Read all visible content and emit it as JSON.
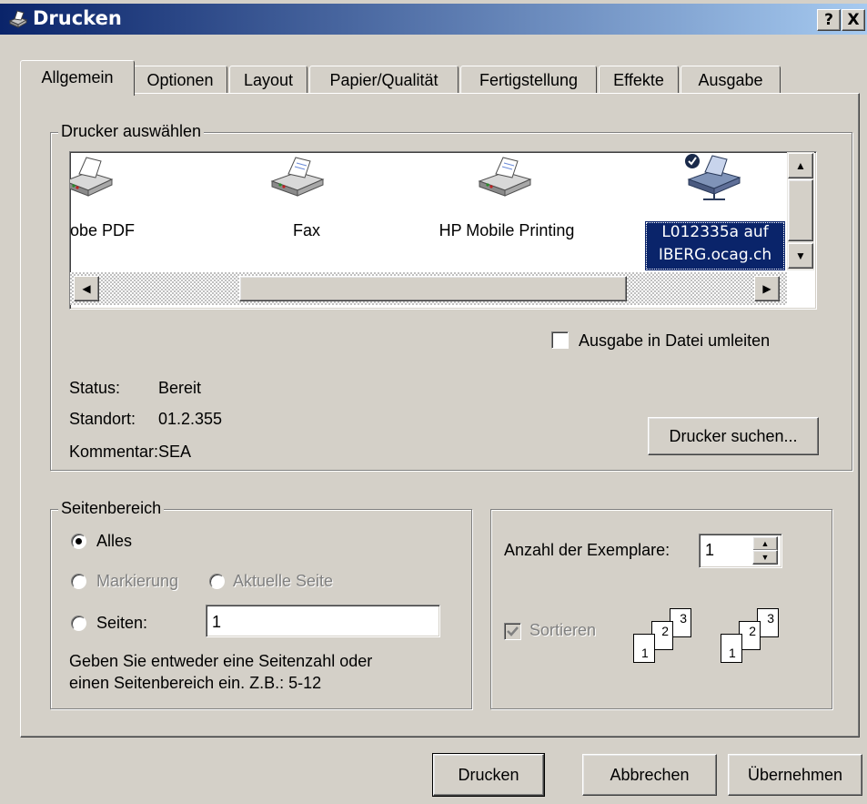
{
  "window": {
    "title": "Drucken",
    "help_button": "?",
    "close_button": "X"
  },
  "tabs": [
    {
      "label": "Allgemein",
      "active": true
    },
    {
      "label": "Optionen",
      "active": false
    },
    {
      "label": "Layout",
      "active": false
    },
    {
      "label": "Papier/Qualität",
      "active": false
    },
    {
      "label": "Fertigstellung",
      "active": false
    },
    {
      "label": "Effekte",
      "active": false
    },
    {
      "label": "Ausgabe",
      "active": false
    }
  ],
  "printer_group": {
    "legend": "Drucker auswählen",
    "printers": [
      {
        "label": "obe PDF"
      },
      {
        "label": "Fax"
      },
      {
        "label": "HP Mobile Printing"
      },
      {
        "label_line1": "L012335a auf",
        "label_line2": "IBERG.ocag.ch",
        "selected": true,
        "default": true
      }
    ],
    "print_to_file_label": "Ausgabe in Datei umleiten",
    "print_to_file_checked": false,
    "status_label": "Status:",
    "status_value": "Bereit",
    "location_label": "Standort:",
    "location_value": "01.2.355",
    "comment_label": "Kommentar:",
    "comment_value": "SEA",
    "find_printer_button": "Drucker suchen..."
  },
  "page_range": {
    "legend": "Seitenbereich",
    "all_label": "Alles",
    "selection_label": "Markierung",
    "current_page_label": "Aktuelle Seite",
    "pages_label": "Seiten:",
    "pages_value": "1",
    "hint_line1": "Geben Sie entweder eine Seitenzahl oder",
    "hint_line2": "einen Seitenbereich ein. Z.B.: 5-12",
    "selected": "all"
  },
  "copies": {
    "label": "Anzahl der Exemplare:",
    "value": "1",
    "collate_label": "Sortieren",
    "collate_checked": true,
    "page_numbers": [
      "1",
      "2",
      "3"
    ]
  },
  "buttons": {
    "print": "Drucken",
    "cancel": "Abbrechen",
    "apply": "Übernehmen"
  }
}
